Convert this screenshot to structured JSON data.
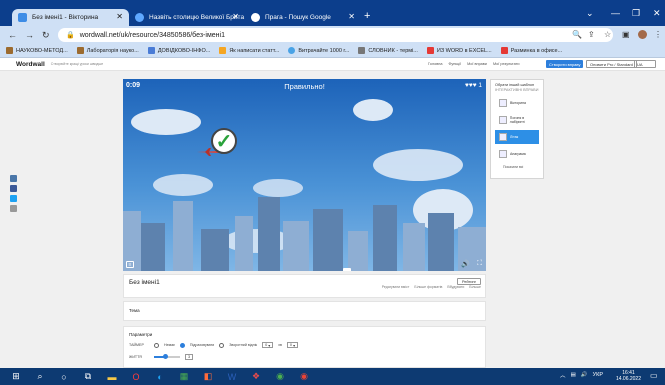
{
  "tabs": [
    {
      "title": "Без імені1 - Вікторина",
      "active": true,
      "favicon_color": "#3d8ce6"
    },
    {
      "title": "Назвіть столицю Великої Брита",
      "active": false,
      "favicon_color": "#5fa8ff"
    },
    {
      "title": "Прага - Пошук Google",
      "active": false,
      "favicon_color": "#fbbc05"
    }
  ],
  "address": {
    "url": "wordwall.net/uk/resource/34850586/без-імені1"
  },
  "bookmarks": [
    {
      "label": "НАУКОВО-МЕТОД...",
      "color": "#9c6b2f"
    },
    {
      "label": "Лабораторія науко...",
      "color": "#9c6b2f"
    },
    {
      "label": "ДОВІДКОВО-ІНФО...",
      "color": "#4a7cd6"
    },
    {
      "label": "Як написати статт...",
      "color": "#f5a623"
    },
    {
      "label": "Витрачайте 1000 г...",
      "color": "#4aa3e6"
    },
    {
      "label": "СЛОВНИК - термі...",
      "color": "#777777"
    },
    {
      "label": "ИЗ WORD в EXCEL...",
      "color": "#e53935"
    },
    {
      "label": "Разминка в офисе...",
      "color": "#e53935"
    }
  ],
  "wordwall": {
    "logo": "Wordwall",
    "tagline": "Створюйте кращі уроки швидше",
    "nav": [
      "Головна",
      "Функції",
      "Мої вправи",
      "Мої результати"
    ],
    "create_button": "Створити вправу",
    "upgrade_button": "Оновити Pro / Standard",
    "lang": "UA"
  },
  "game": {
    "timer": "0:09",
    "title": "Правильно!",
    "lives": "♥♥♥ 1"
  },
  "template_panel": {
    "heading": "Обрати інший шаблон",
    "subheading": "ІНТЕРАКТИВНІ ВПРАВИ",
    "items": [
      {
        "label": "Вікторина",
        "active": false
      },
      {
        "label": "Погоня в лабіринті",
        "active": false
      },
      {
        "label": "Літак",
        "active": true
      },
      {
        "label": "Анаграма",
        "active": false
      }
    ],
    "more": "Показати всі"
  },
  "resource": {
    "title": "Без імені1",
    "leaderboard_button": "Рейтинг",
    "actions": [
      "Редагувати вміст",
      "Більше форматів",
      "Вбудувати",
      "Більше"
    ]
  },
  "theme": {
    "title": "Тема"
  },
  "params": {
    "title": "Параметри",
    "timer_label": "ТАЙМЕР",
    "timer_options": [
      "Немає",
      "Підраховувати",
      "Зворотний відлік"
    ],
    "timer_min": "0",
    "timer_sec": "0",
    "unit_label": "хв",
    "lives_label": "ЖИТТЯ",
    "lives_value": "3"
  },
  "taskbar": {
    "lang": "УКР",
    "time": "16:41",
    "date": "14.06.2022"
  }
}
